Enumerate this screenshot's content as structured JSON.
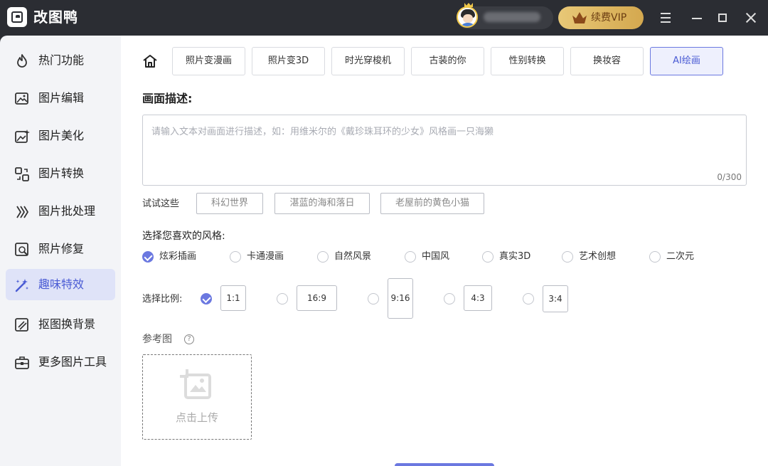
{
  "app": {
    "title": "改图鸭"
  },
  "header": {
    "vip_label": "续费VIP"
  },
  "sidebar": {
    "items": [
      {
        "label": "热门功能",
        "icon": "fire-icon"
      },
      {
        "label": "图片编辑",
        "icon": "image-edit-icon"
      },
      {
        "label": "图片美化",
        "icon": "image-beautify-icon"
      },
      {
        "label": "图片转换",
        "icon": "convert-icon"
      },
      {
        "label": "图片批处理",
        "icon": "batch-icon"
      },
      {
        "label": "照片修复",
        "icon": "photo-repair-icon"
      },
      {
        "label": "趣味特效",
        "icon": "magic-wand-icon"
      },
      {
        "label": "抠图换背景",
        "icon": "cutout-icon"
      },
      {
        "label": "更多图片工具",
        "icon": "toolbox-icon"
      }
    ],
    "active_index": 6
  },
  "tabs": {
    "items": [
      {
        "label": "照片变漫画"
      },
      {
        "label": "照片变3D"
      },
      {
        "label": "时光穿梭机"
      },
      {
        "label": "古装的你"
      },
      {
        "label": "性别转换"
      },
      {
        "label": "换妆容"
      },
      {
        "label": "AI绘画"
      }
    ],
    "active_index": 6
  },
  "description": {
    "title": "画面描述:",
    "placeholder": "请输入文本对画面进行描述，如：用维米尔的《戴珍珠耳环的少女》风格画一只海獭",
    "value": "",
    "char_count": "0/300"
  },
  "suggestions": {
    "label": "试试这些",
    "chips": [
      "科幻世界",
      "湛蓝的海和落日",
      "老屋前的黄色小猫"
    ]
  },
  "style": {
    "label": "选择您喜欢的风格:",
    "options": [
      "炫彩插画",
      "卡通漫画",
      "自然风景",
      "中国风",
      "真实3D",
      "艺术创想",
      "二次元"
    ],
    "selected_index": 0
  },
  "ratio": {
    "label": "选择比例:",
    "options": [
      "1:1",
      "16:9",
      "9:16",
      "4:3",
      "3:4"
    ],
    "selected_index": 0
  },
  "reference": {
    "label": "参考图",
    "help": "?",
    "upload_text": "点击上传"
  },
  "colors": {
    "accent": "#6b78e0",
    "titlebar": "#2b2d33",
    "sidebar_bg": "#f3f4f7",
    "active_bg": "#dfe3f8",
    "vip_gold": "#e0bd6c"
  }
}
